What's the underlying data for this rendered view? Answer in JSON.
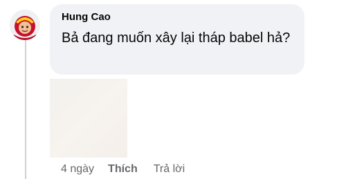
{
  "comment": {
    "author": "Hung Cao",
    "text": "Bả đang muốn xây lại tháp babel hả?",
    "time": "4 ngày",
    "like_label": "Thích",
    "reply_label": "Trả lời"
  },
  "colors": {
    "bubble": "#f0f2f5",
    "text": "#050505",
    "meta": "#65676b",
    "avatar_bg": "#e8eaed",
    "avatar_red": "#c8102e",
    "avatar_skin": "#f2c199",
    "avatar_gold": "#f7d417"
  },
  "icons": {
    "avatar": "cartoon-character-avatar"
  }
}
